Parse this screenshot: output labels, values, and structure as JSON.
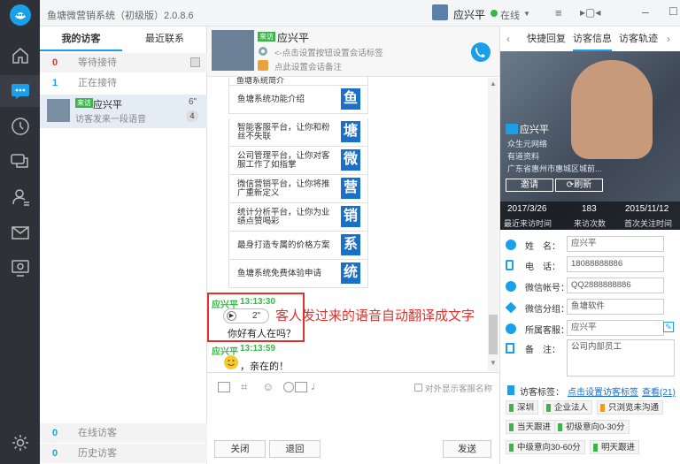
{
  "app": {
    "title": "鱼塘微营销系统（初级版）2.0.8.6",
    "user_name": "应兴平",
    "status": "在线",
    "colors": {
      "sidebar": "#2f3138",
      "accent": "#1aa0e8",
      "highlight_box": "#e0322d",
      "menu_icon": "#1a6fc9"
    }
  },
  "sidebar": {
    "items": [
      {
        "name": "logo-icon"
      },
      {
        "name": "home-icon"
      },
      {
        "name": "chat-icon"
      },
      {
        "name": "history-icon"
      },
      {
        "name": "messages-icon"
      },
      {
        "name": "contacts-icon"
      },
      {
        "name": "mail-icon"
      },
      {
        "name": "monitor-icon"
      },
      {
        "name": "settings-icon"
      }
    ]
  },
  "visitors": {
    "tabs": [
      "我的访客",
      "最近联系"
    ],
    "groups": [
      {
        "count": "0",
        "label": "等待接待"
      },
      {
        "count": "1",
        "label": "正在接待"
      }
    ],
    "entry": {
      "badge": "来访",
      "name": "应兴平",
      "preview": "访客发来一段语音",
      "duration": "6\"",
      "unread": "4"
    },
    "bottom_groups": [
      {
        "count": "0",
        "label": "在线访客"
      },
      {
        "count": "0",
        "label": "历史访客"
      }
    ]
  },
  "chat": {
    "header": {
      "badge": "来访",
      "name": "应兴平",
      "tag_hint": "<-点击设置按钮设置会话标签",
      "note_hint": "点此设置会话备注"
    },
    "menu_title": "鱼塘系统简介",
    "menu_items": [
      {
        "text": "鱼塘系统功能介绍",
        "icon": "鱼"
      },
      {
        "text": "智能客服平台，让你和粉丝不失联",
        "icon": "塘"
      },
      {
        "text": "公司管理平台，让你对客服工作了如指掌",
        "icon": "微"
      },
      {
        "text": "微信营销平台，让你将推广重新定义",
        "icon": "营"
      },
      {
        "text": "统计分析平台，让你为业绩点赞喝彩",
        "icon": "销"
      },
      {
        "text": "最身打造专属的价格方案",
        "icon": "系"
      },
      {
        "text": "鱼塘系统免费体验申请",
        "icon": "统"
      }
    ],
    "messages": [
      {
        "sender": "应兴平",
        "time": "13:13:30",
        "voice_duration": "2\"",
        "text": "你好有人在吗？"
      },
      {
        "sender": "应兴平",
        "time": "13:13:59",
        "text": "，亲在的！"
      }
    ],
    "annotation": "客人发过来的语音自动翻译成文字",
    "show_name_label": "对外显示客服名称",
    "buttons": {
      "close": "关闭",
      "back": "退回",
      "send": "发送"
    }
  },
  "right": {
    "tabs": [
      "快捷回复",
      "访客信息",
      "访客轨迹"
    ],
    "profile": {
      "name": "应兴平",
      "source": "众生元网络",
      "note": "有道资料",
      "location": "广东省惠州市惠城区城前...",
      "invite": "邀请",
      "refresh": "刷新",
      "stats": [
        {
          "value": "2017/3/26",
          "label": "最近来访时间"
        },
        {
          "value": "183",
          "label": "来访次数"
        },
        {
          "value": "2015/11/12",
          "label": "首次关注时间"
        }
      ]
    },
    "fields": [
      {
        "icon": "user-icon",
        "key": "姓　名：",
        "value": "应兴平"
      },
      {
        "icon": "phone-icon",
        "key": "电　话：",
        "value": "18088888886"
      },
      {
        "icon": "wechat-icon",
        "key": "微信帐号：",
        "value": "QQ2888888886"
      },
      {
        "icon": "layers-icon",
        "key": "微信分组：",
        "value": "鱼塘软件"
      },
      {
        "icon": "agent-icon",
        "key": "所属客服：",
        "value": "应兴平"
      },
      {
        "icon": "note-icon",
        "key": "备　注：",
        "value": "公司内部员工"
      }
    ],
    "tags_label": "访客标签：",
    "tags_link": "点击设置访客标签",
    "tags_view": "查看(21)",
    "tags": [
      {
        "text": "深圳",
        "color": "#3bb54a"
      },
      {
        "text": "企业法人",
        "color": "#3bb54a"
      },
      {
        "text": "只浏览未沟通",
        "color": "#f39c12"
      },
      {
        "text": "当天跟进",
        "color": "#3bb54a"
      },
      {
        "text": "初级意向0-30分",
        "color": "#3bb54a"
      },
      {
        "text": "中级意向30-60分",
        "color": "#3bb54a"
      },
      {
        "text": "明天跟进",
        "color": "#3bb54a"
      }
    ]
  }
}
